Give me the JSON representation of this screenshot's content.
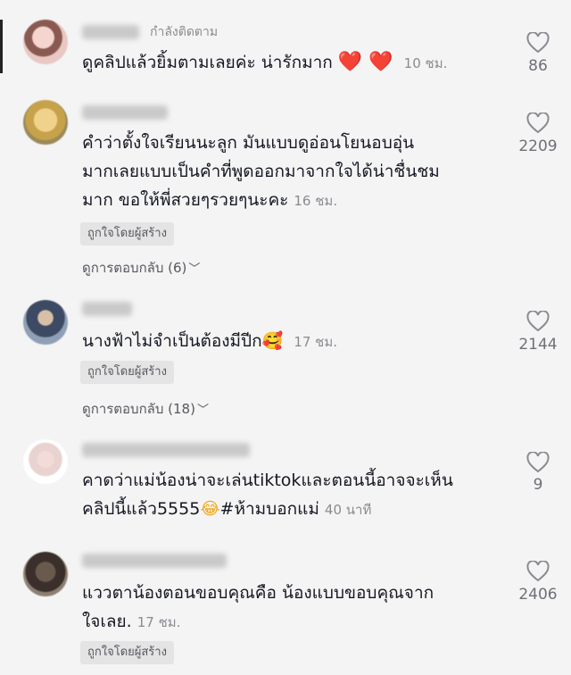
{
  "comments": [
    {
      "following": "กำลังติดตาม",
      "text": "ดูคลิปแล้วยิ้มตามเลยค่ะ น่ารักมาก",
      "emoji": "❤️ ❤️",
      "time": "10 ชม.",
      "likes": "86"
    },
    {
      "text": "คำว่าตั้งใจเรียนนะลูก มันแบบดูอ่อนโยนอบอุ่นมากเลยแบบเป็นคำที่พูดออกมาจากใจได้น่าชื่นชมมาก ขอให้พี่สวยๆรวยๆนะคะ",
      "line1": "คำว่าตั้งใจเรียนนะลูก มันแบบดูอ่อนโยนอบอุ่น",
      "line2": "มากเลยแบบเป็นคำที่พูดออกมาจากใจได้น่าชื่นชม",
      "line3": "มาก ขอให้พี่สวยๆรวยๆนะคะ",
      "time": "16 ชม.",
      "badge": "ถูกใจโดยผู้สร้าง",
      "replies": "ดูการตอบกลับ (6)",
      "likes": "2209"
    },
    {
      "text": "นางฟ้าไม่จำเป็นต้องมีปีก",
      "emoji": "🥰",
      "time": "17 ชม.",
      "badge": "ถูกใจโดยผู้สร้าง",
      "replies": "ดูการตอบกลับ (18)",
      "likes": "2144"
    },
    {
      "line1": "คาดว่าแม่น้องน่าจะเล่นtiktokและตอนนี้อาจจะเห็น",
      "line2_a": "คลิปนี้แล้ว5555",
      "emoji": "😂",
      "line2_b": "#ห้ามบอกแม่",
      "time": "40 นาที",
      "likes": "9"
    },
    {
      "line1": "แววตาน้องตอนขอบคุณคือ น้องแบบขอบคุณจาก",
      "line2": "ใจเลย.",
      "time": "17 ชม.",
      "badge": "ถูกใจโดยผู้สร้าง",
      "likes": "2406"
    }
  ],
  "icons": {
    "like": "heart-outline-icon",
    "replies_chevron": "chevron-down-icon"
  },
  "colors": {
    "background": "#f4f4f4",
    "text": "#161823",
    "muted": "#8a8b91",
    "badge_bg": "#e4e4e4",
    "heart": "#e8202e"
  }
}
